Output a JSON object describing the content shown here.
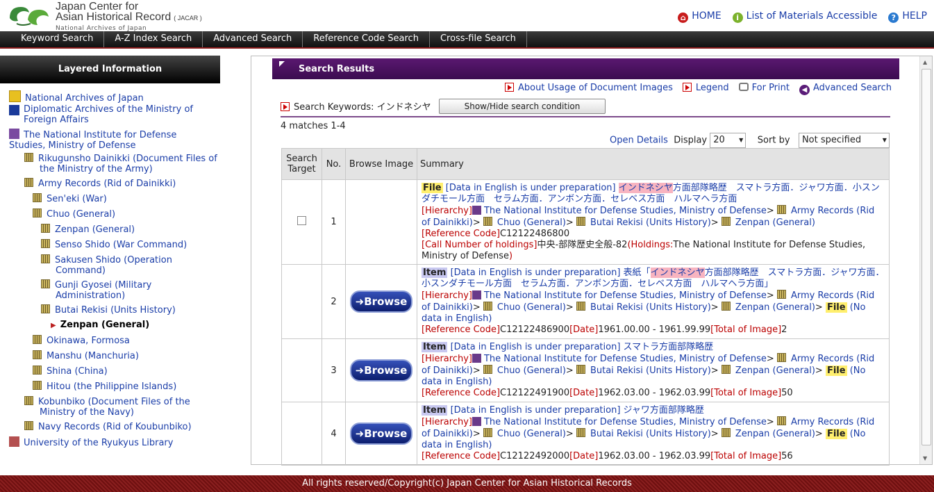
{
  "header": {
    "brand_line1": "Japan Center for",
    "brand_line2": "Asian Historical Record",
    "brand_abbr": "( JACAR )",
    "brand_line3": "National Archives of Japan",
    "links": [
      {
        "label": "HOME",
        "icon": "home-icon",
        "color": "#c81c1c"
      },
      {
        "label": "List of Materials Accessible",
        "icon": "info-icon",
        "color": "#7cb22c"
      },
      {
        "label": "HELP",
        "icon": "help-icon",
        "color": "#2a7ad0"
      }
    ]
  },
  "nav": [
    "Keyword Search",
    "A-Z Index Search",
    "Advanced Search",
    "Reference Code Search",
    "Cross-file Search"
  ],
  "sidebar": {
    "title": "Layered Information",
    "items": [
      {
        "label": "National Archives of Japan"
      },
      {
        "label": "Diplomatic Archives of the Ministry of Foreign Affairs"
      },
      {
        "label": "The National Institute for Defense Studies, Ministry of Defense"
      },
      {
        "label": "Rikugunsho Dainikki (Document Files of the Ministry of the Army)"
      },
      {
        "label": "Army Records (Rid of Dainikki)"
      },
      {
        "label": "Sen'eki (War)"
      },
      {
        "label": "Chuo (General)"
      },
      {
        "label": "Zenpan (General)"
      },
      {
        "label": "Senso Shido (War Command)"
      },
      {
        "label": "Sakusen Shido (Operation Command)"
      },
      {
        "label": "Gunji Gyosei (Military Administration)"
      },
      {
        "label": "Butai Rekisi (Units History)"
      },
      {
        "label": "Zenpan (General)"
      },
      {
        "label": "Okinawa, Formosa"
      },
      {
        "label": "Manshu (Manchuria)"
      },
      {
        "label": "Shina (China)"
      },
      {
        "label": "Hitou (the Philippine Islands)"
      },
      {
        "label": "Kobunbiko (Document Files of the Ministry of the Navy)"
      },
      {
        "label": "Navy Records (Rid of Koubunbiko)"
      },
      {
        "label": "University of the Ryukyus Library"
      }
    ]
  },
  "results": {
    "title": "Search Results",
    "links": [
      "About Usage of Document Images",
      "Legend",
      "For Print",
      "Advanced Search"
    ],
    "keyword_label": "Search Keywords:",
    "keyword": "インドネシヤ",
    "toggle_button": "Show/Hide search condition",
    "matches": "4 matches 1-4",
    "open_details": "Open Details",
    "display_label": "Display",
    "display_value": "20",
    "sort_label": "Sort by",
    "sort_value": "Not specified",
    "columns": [
      "Search Target",
      "No.",
      "Browse Image",
      "Summary"
    ],
    "browse_label": "Browse",
    "rows": [
      {
        "no": "1",
        "tag": "File",
        "prep": "[Data in English is under preparation]",
        "title_pre": "",
        "title_hl": "インドネシヤ",
        "title_post": "方面部隊略歴　スマトラ方面．ジャワ方面．小スンダチモール方面　セラム方面．アンボン方面．セレベス方面　ハルマヘラ方面",
        "hier_label": "[Hierarchy]",
        "hier_1": "The National Institute for Defense Studies, Ministry of Defense",
        "hier_2": "Army Records (Rid of Dainikki)",
        "hier_3": "Chuo (General)",
        "hier_4": "Butai Rekisi (Units History)",
        "hier_5": "Zenpan (General)",
        "ref_label": "[Reference Code]",
        "ref": "C12122486800",
        "call_label": "[Call Number of holdings]",
        "call": "中央-部隊歴史全般-82",
        "hold_label": "(Holdings:",
        "hold": "The National Institute for Defense Studies, Ministry of Defense",
        "hold_close": ")"
      },
      {
        "no": "2",
        "tag": "Item",
        "prep": "[Data in English is under preparation]",
        "title_pre": "表紙「",
        "title_hl": "インドネシヤ",
        "title_post": "方面部隊略歴　スマトラ方面．ジャワ方面．小スンダチモール方面　セラム方面．アンボン方面．セレベス方面　ハルマヘラ方面」",
        "hier_label": "[Hierarchy]",
        "hier_1": "The National Institute for Defense Studies, Ministry of Defense",
        "hier_2": "Army Records (Rid of Dainikki)",
        "hier_3": "Chuo (General)",
        "hier_4": "Butai Rekisi (Units History)",
        "hier_5": "Zenpan (General)",
        "file_tag": "File",
        "file_note": "(No data in English)",
        "ref_label": "[Reference Code]",
        "ref": "C12122486900",
        "date_label": "[Date]",
        "date": "1961.00.00 - 1961.99.99",
        "total_label": "[Total of Image]",
        "total": "2"
      },
      {
        "no": "3",
        "tag": "Item",
        "prep": "[Data in English is under preparation]",
        "title_pre": "スマトラ方面部隊略歴",
        "title_hl": "",
        "title_post": "",
        "hier_label": "[Hierarchy]",
        "hier_1": "The National Institute for Defense Studies, Ministry of Defense",
        "hier_2": "Army Records (Rid of Dainikki)",
        "hier_3": "Chuo (General)",
        "hier_4": "Butai Rekisi (Units History)",
        "hier_5": "Zenpan (General)",
        "file_tag": "File",
        "file_note": "(No data in English)",
        "ref_label": "[Reference Code]",
        "ref": "C12122491900",
        "date_label": "[Date]",
        "date": "1962.03.00 - 1962.03.99",
        "total_label": "[Total of Image]",
        "total": "50"
      },
      {
        "no": "4",
        "tag": "Item",
        "prep": "[Data in English is under preparation]",
        "title_pre": "ジャワ方面部隊略歴",
        "title_hl": "",
        "title_post": "",
        "hier_label": "[Hierarchy]",
        "hier_1": "The National Institute for Defense Studies, Ministry of Defense",
        "hier_2": "Army Records (Rid of Dainikki)",
        "hier_3": "Chuo (General)",
        "hier_4": "Butai Rekisi (Units History)",
        "hier_5": "Zenpan (General)",
        "file_tag": "File",
        "file_note": "(No data in English)",
        "ref_label": "[Reference Code]",
        "ref": "C12122492000",
        "date_label": "[Date]",
        "date": "1962.03.00 - 1962.03.99",
        "total_label": "[Total of Image]",
        "total": "56"
      }
    ]
  },
  "footer": "All rights reserved/Copyright(c) Japan Center for Asian Historical Records"
}
